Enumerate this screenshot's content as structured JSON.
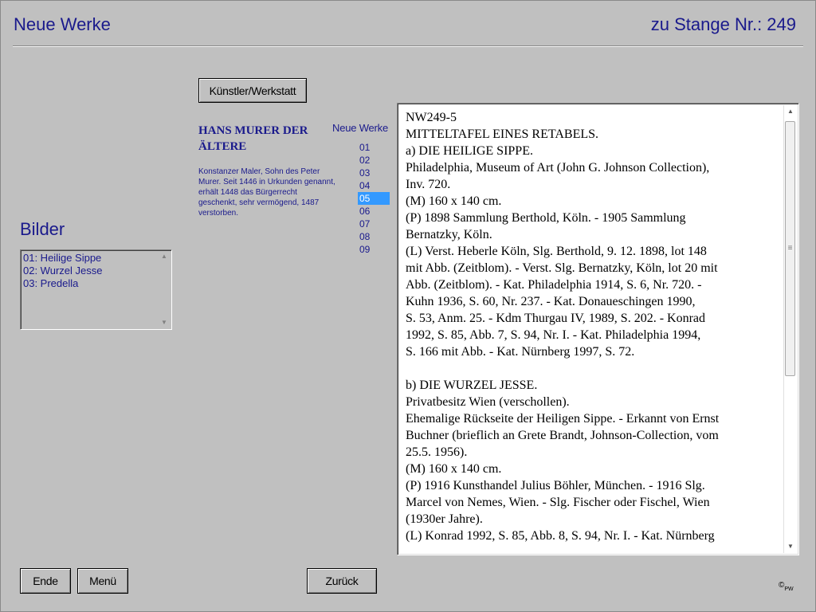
{
  "header": {
    "title": "Neue Werke",
    "stange": "zu Stange Nr.: 249"
  },
  "toolbar": {
    "artist_button": "Künstler/Werkstatt"
  },
  "artist": {
    "name": "HANS MURER DER ÄLTERE",
    "bio": "Konstanzer Maler, Sohn des Peter Murer. Seit 1446 in Urkunden genannt, erhält 1448 das Bürgerrecht geschenkt, sehr vermögend, 1487 verstorben."
  },
  "works_list": {
    "label": "Neue Werke",
    "items": [
      "01",
      "02",
      "03",
      "04",
      "05",
      "06",
      "07",
      "08",
      "09"
    ],
    "selected": "05"
  },
  "bilder": {
    "label": "Bilder",
    "items": [
      "01: Heilige Sippe",
      "02: Wurzel Jesse",
      "03: Predella"
    ]
  },
  "detail": {
    "paragraphs": [
      "NW249-5",
      "MITTELTAFEL EINES RETABELS.",
      "a) DIE HEILIGE SIPPE.",
      "Philadelphia, Museum of Art  (John G. Johnson Collection),\nInv. 720.",
      "(M) 160 x 140 cm.",
      "(P) 1898 Sammlung Berthold, Köln. - 1905 Sammlung\nBernatzky, Köln.",
      "(L) Verst. Heberle Köln, Slg. Berthold, 9. 12. 1898, lot 148\nmit Abb.  (Zeitblom). - Verst. Slg. Bernatzky, Köln, lot 20 mit\nAbb. (Zeitblom). - Kat. Philadelphia 1914, S. 6, Nr. 720. -\nKuhn 1936, S. 60, Nr. 237. - Kat. Donaueschingen 1990,\nS. 53, Anm. 25. - Kdm Thurgau IV, 1989, S. 202. - Konrad\n1992, S. 85, Abb. 7, S. 94, Nr. I. - Kat. Philadelphia 1994,\nS. 166 mit Abb. - Kat. Nürnberg 1997, S. 72.",
      "",
      "b) DIE WURZEL JESSE.",
      "Privatbesitz Wien (verschollen).",
      "Ehemalige Rückseite der Heiligen Sippe. - Erkannt von Ernst\nBuchner (brieflich an Grete Brandt, Johnson-Collection, vom\n25.5. 1956).",
      "(M) 160 x 140 cm.",
      "(P) 1916 Kunsthandel Julius Böhler, München. - 1916 Slg.\nMarcel von Nemes, Wien. - Slg. Fischer oder Fischel, Wien\n(1930er Jahre).",
      "(L) Konrad 1992, S. 85, Abb. 8, S. 94, Nr. I. - Kat. Nürnberg"
    ]
  },
  "footer": {
    "ende": "Ende",
    "menu": "Menü",
    "zurueck": "Zurück",
    "copyright_symbol": "©",
    "copyright_initials": "PW"
  }
}
